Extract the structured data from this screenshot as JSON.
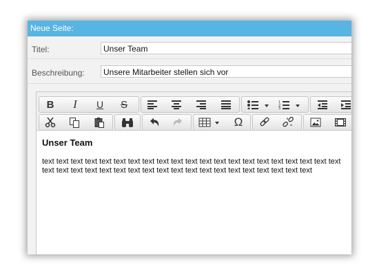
{
  "dialog": {
    "title": "Neue Seite:"
  },
  "form": {
    "title_label": "Titel:",
    "title_value": "Unser Team",
    "description_label": "Beschreibung:",
    "description_value": "Unsere Mitarbeiter stellen sich vor"
  },
  "toolbar": {
    "row1": [
      "bold-icon",
      "italic-icon",
      "underline-icon",
      "strikethrough-icon",
      "align-left-icon",
      "align-center-icon",
      "align-right-icon",
      "align-justify-icon",
      "bullet-list-icon",
      "numbered-list-icon",
      "outdent-icon",
      "indent-icon"
    ],
    "row2": [
      "cut-icon",
      "copy-icon",
      "paste-icon",
      "find-icon",
      "undo-icon",
      "redo-icon",
      "table-icon",
      "special-char-icon",
      "link-icon",
      "unlink-icon",
      "image-icon",
      "media-icon"
    ],
    "labels": {
      "bold": "B",
      "italic": "I",
      "underline": "U",
      "strikethrough": "S",
      "special_char": "Ω"
    }
  },
  "editor": {
    "heading": "Unser Team",
    "body": "text text text text text text text text text text text text text text text text text text text text text text text text text text text text text text text text text text text text text text text text"
  },
  "colors": {
    "titlebar": "#58b4e2",
    "dialog_bg": "#f2f2f2"
  }
}
